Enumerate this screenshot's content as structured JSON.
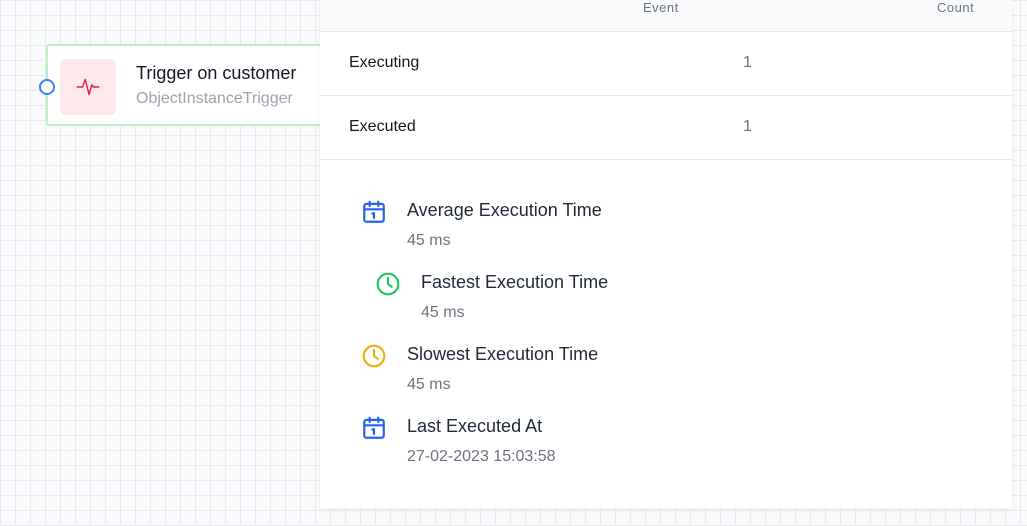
{
  "node": {
    "title": "Trigger on customer",
    "subtitle": "ObjectInstanceTrigger",
    "icon": "activity-pulse-icon",
    "icon_color": "#e11d48",
    "border_color": "#bbf0c9",
    "port_color": "#3b82f6"
  },
  "table": {
    "headers": {
      "event": "Event",
      "count": "Count"
    },
    "rows": [
      {
        "event": "Executing",
        "count": "1"
      },
      {
        "event": "Executed",
        "count": "1"
      }
    ]
  },
  "stats": [
    {
      "icon": "calendar-icon",
      "icon_color": "#2563eb",
      "title": "Average Execution Time",
      "value": "45 ms"
    },
    {
      "icon": "clock-icon",
      "icon_color": "#22c55e",
      "title": "Fastest Execution Time",
      "value": "45 ms"
    },
    {
      "icon": "clock-icon",
      "icon_color": "#eab308",
      "title": "Slowest Execution Time",
      "value": "45 ms"
    },
    {
      "icon": "calendar-icon",
      "icon_color": "#2563eb",
      "title": "Last Executed At",
      "value": "27-02-2023 15:03:58"
    }
  ]
}
